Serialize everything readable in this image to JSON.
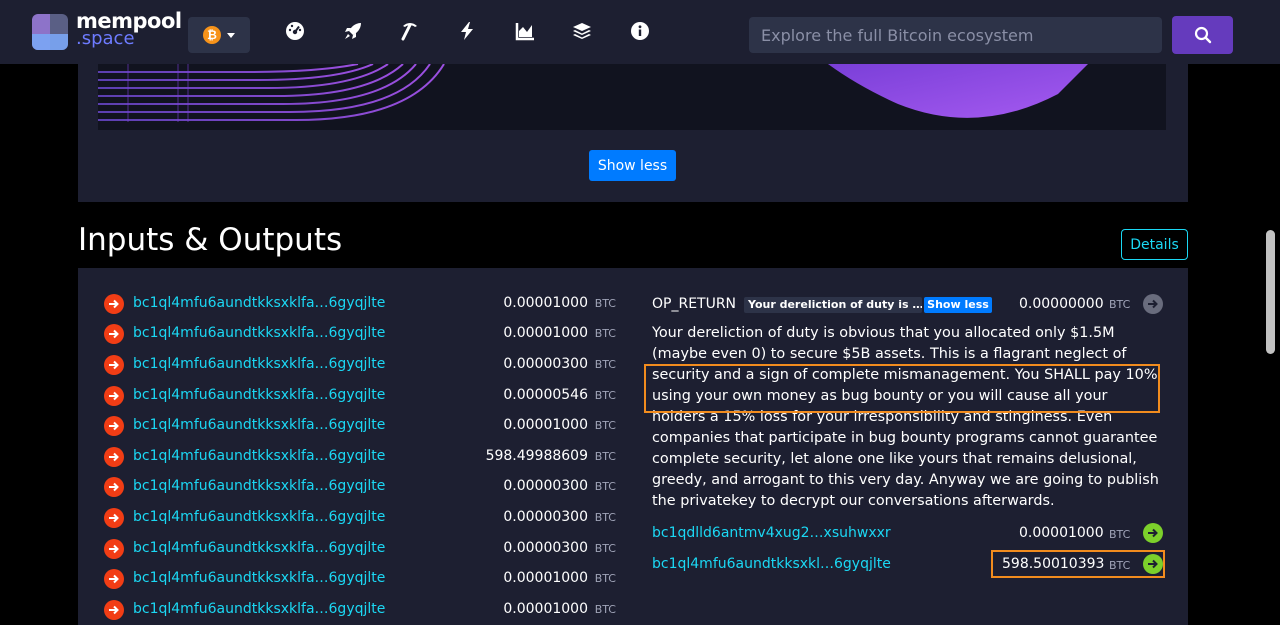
{
  "brand": {
    "name_line1": "mempool",
    "name_line2": ".space"
  },
  "network": {
    "symbol": "₿"
  },
  "nav_icons": [
    "dashboard-icon",
    "rocket-icon",
    "mining-icon",
    "lightning-icon",
    "graphs-icon",
    "layers-icon",
    "info-icon"
  ],
  "search": {
    "placeholder": "Explore the full Bitcoin ecosystem"
  },
  "graph": {
    "toggle_label": "Show less"
  },
  "io": {
    "title": "Inputs & Outputs",
    "details_label": "Details",
    "unit": "BTC",
    "inputs": [
      {
        "address": "bc1ql4mfu6aundtkksxklfa…6gyqjlte",
        "amount": "0.00001000"
      },
      {
        "address": "bc1ql4mfu6aundtkksxklfa…6gyqjlte",
        "amount": "0.00001000"
      },
      {
        "address": "bc1ql4mfu6aundtkksxklfa…6gyqjlte",
        "amount": "0.00000300"
      },
      {
        "address": "bc1ql4mfu6aundtkksxklfa…6gyqjlte",
        "amount": "0.00000546"
      },
      {
        "address": "bc1ql4mfu6aundtkksxklfa…6gyqjlte",
        "amount": "0.00001000"
      },
      {
        "address": "bc1ql4mfu6aundtkksxklfa…6gyqjlte",
        "amount": "598.49988609"
      },
      {
        "address": "bc1ql4mfu6aundtkksxklfa…6gyqjlte",
        "amount": "0.00000300"
      },
      {
        "address": "bc1ql4mfu6aundtkksxklfa…6gyqjlte",
        "amount": "0.00000300"
      },
      {
        "address": "bc1ql4mfu6aundtkksxklfa…6gyqjlte",
        "amount": "0.00000300"
      },
      {
        "address": "bc1ql4mfu6aundtkksxklfa…6gyqjlte",
        "amount": "0.00001000"
      },
      {
        "address": "bc1ql4mfu6aundtkksxklfa…6gyqjlte",
        "amount": "0.00001000"
      }
    ],
    "op_return": {
      "label": "OP_RETURN",
      "badge_text": "Your dereliction of duty is …",
      "toggle_label": "Show less",
      "amount": "0.00000000",
      "message": "Your dereliction of duty is obvious that you allocated only $1.5M (maybe even 0) to secure $5B assets. This is a flagrant neglect of security and a sign of complete mismanagement. You SHALL pay 10% using your own money as bug bounty or you will cause all your holders a 15% loss for your irresponsibility and stinginess. Even companies that participate in bug bounty programs cannot guarantee complete security, let alone one like yours that remains delusional, greedy, and arrogant to this very day. Anyway we are going to publish the privatekey to decrypt our conversations afterwards."
    },
    "outputs": [
      {
        "address": "bc1qdlld6antmv4xug2…xsuhwxxr",
        "amount": "0.00001000"
      },
      {
        "address": "bc1ql4mfu6aundtkksxkl…6gyqjlte",
        "amount": "598.50010393"
      }
    ]
  }
}
